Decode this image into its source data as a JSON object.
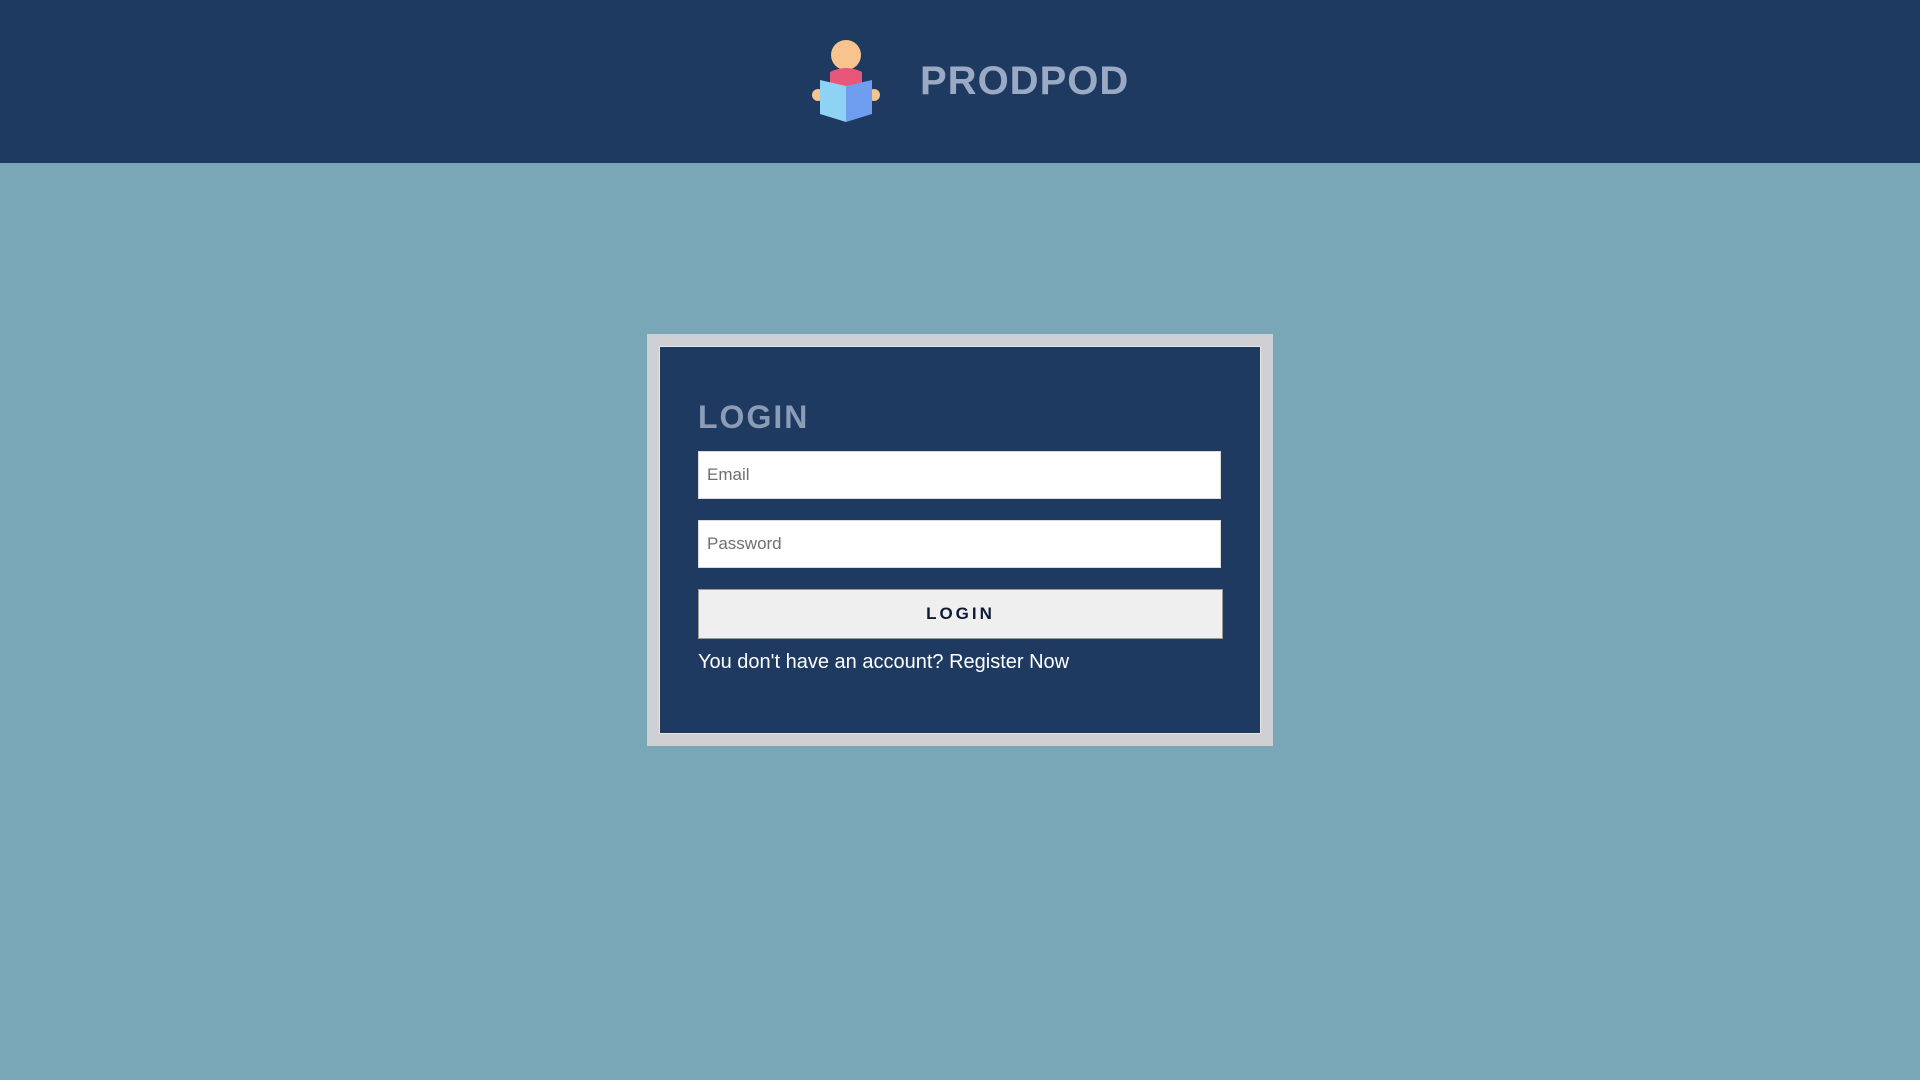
{
  "header": {
    "brand_name": "PRODPOD",
    "logo_icon": "reader-with-book-icon",
    "background_color": "#1f3a60"
  },
  "login": {
    "title": "LOGIN",
    "email_placeholder": "Email",
    "email_value": "",
    "password_placeholder": "Password",
    "password_value": "",
    "button_label": "LOGIN",
    "register_prompt": "You don't have an account?",
    "register_link": "Register Now"
  },
  "colors": {
    "page_background": "#7aa7b8",
    "card_background": "#1f3a60",
    "frame_border": "#cfd0d4",
    "title_text": "#8c9cb6",
    "brand_text": "#9aa9c4"
  }
}
